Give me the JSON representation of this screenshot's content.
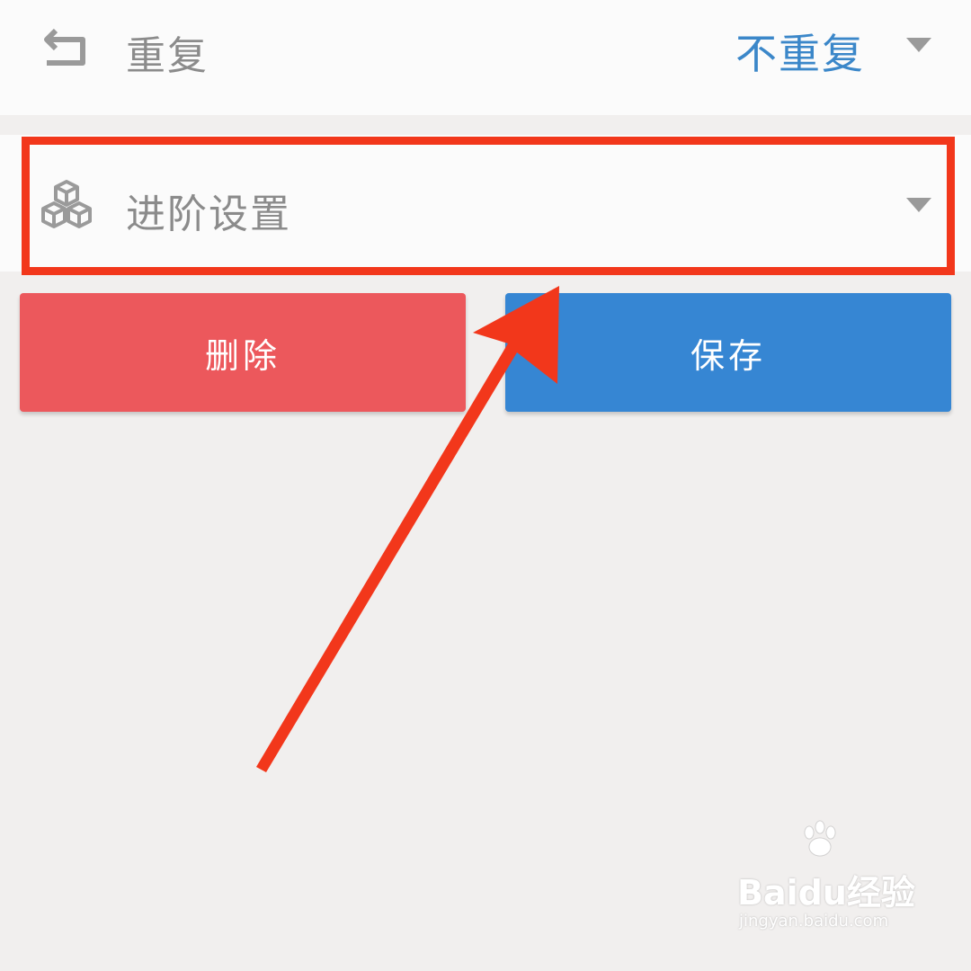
{
  "repeat_row": {
    "label": "重复",
    "value": "不重复",
    "icon": "undo-icon"
  },
  "advanced_row": {
    "label": "进阶设置",
    "icon": "cubes-icon"
  },
  "buttons": {
    "delete_label": "删除",
    "save_label": "保存"
  },
  "watermark": {
    "brand": "Baidu经验",
    "url": "jingyan.baidu.com"
  },
  "colors": {
    "value_accent": "#3b87c9",
    "delete": "#ec585c",
    "save": "#3686d3",
    "annotation": "#f2371b"
  }
}
